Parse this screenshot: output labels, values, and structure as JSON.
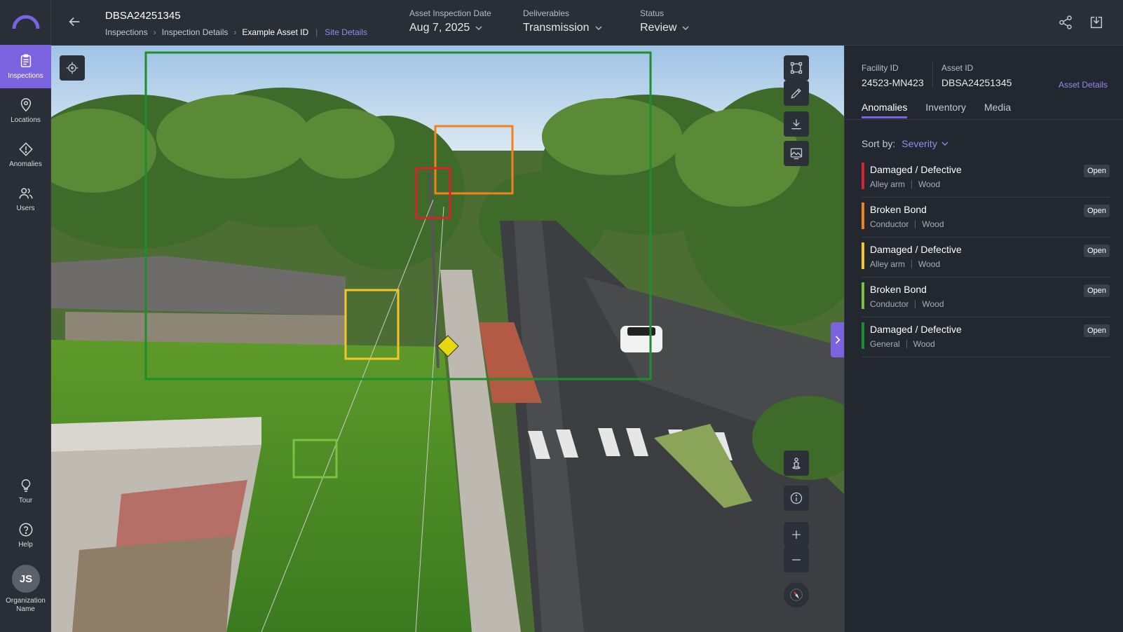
{
  "sidebar": {
    "items": [
      {
        "label": "Inspections",
        "icon": "clipboard-icon",
        "active": true
      },
      {
        "label": "Locations",
        "icon": "map-pin-icon"
      },
      {
        "label": "Anomalies",
        "icon": "alert-diamond-icon"
      },
      {
        "label": "Users",
        "icon": "users-icon"
      }
    ],
    "bottom": [
      {
        "label": "Tour",
        "icon": "lightbulb-icon"
      },
      {
        "label": "Help",
        "icon": "help-circle-icon"
      }
    ],
    "avatar_initials": "JS",
    "org_name": "Organization Name"
  },
  "header": {
    "title": "DBSA24251345",
    "breadcrumbs": [
      "Inspections",
      "Inspection Details",
      "Example Asset ID"
    ],
    "site_details": "Site Details",
    "fields": [
      {
        "label": "Asset Inspection Date",
        "value": "Aug 7, 2025"
      },
      {
        "label": "Deliverables",
        "value": "Transmission"
      },
      {
        "label": "Status",
        "value": "Review"
      }
    ]
  },
  "panel": {
    "facility_label": "Facility ID",
    "facility_value": "24523-MN423",
    "asset_label": "Asset ID",
    "asset_value": "DBSA24251345",
    "asset_details": "Asset Details",
    "tabs": [
      "Anomalies",
      "Inventory",
      "Media"
    ],
    "sort_label": "Sort by:",
    "sort_value": "Severity",
    "anomalies": [
      {
        "title": "Damaged / Defective",
        "component": "Alley arm",
        "material": "Wood",
        "status": "Open",
        "color": "#d8232a"
      },
      {
        "title": "Broken Bond",
        "component": "Conductor",
        "material": "Wood",
        "status": "Open",
        "color": "#f0821e"
      },
      {
        "title": "Damaged / Defective",
        "component": "Alley arm",
        "material": "Wood",
        "status": "Open",
        "color": "#f5c52a"
      },
      {
        "title": "Broken Bond",
        "component": "Conductor",
        "material": "Wood",
        "status": "Open",
        "color": "#7cc242"
      },
      {
        "title": "Damaged / Defective",
        "component": "General",
        "material": "Wood",
        "status": "Open",
        "color": "#1e8e2c"
      }
    ]
  },
  "colors": {
    "accent": "#7b63e0"
  }
}
